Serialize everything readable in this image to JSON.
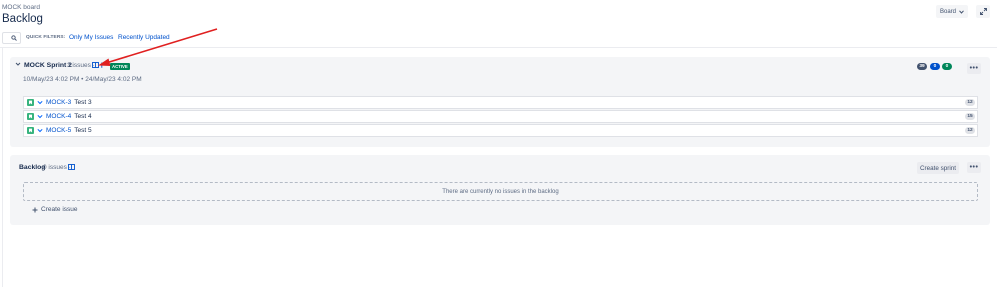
{
  "header": {
    "breadcrumb": "MOCK board",
    "title": "Backlog",
    "board_button": "Board",
    "board_button_icon": "chevron-down-icon",
    "expand_icon": "expand-icon"
  },
  "filters": {
    "search_icon": "search-icon",
    "quick_filters_label": "QUICK FILTERS:",
    "items": [
      "Only My Issues",
      "Recently Updated"
    ]
  },
  "sprint": {
    "name": "MOCK Sprint 2",
    "issue_count": "3 issues",
    "separator": "·",
    "status": "ACTIVE",
    "dates": "10/May/23 4:02 PM  •  24/May/23 4:02 PM",
    "points": [
      {
        "value": "39",
        "color": "#42526e"
      },
      {
        "value": "0",
        "color": "#0052cc"
      },
      {
        "value": "0",
        "color": "#00875a"
      }
    ],
    "more_label": "•••",
    "issues": [
      {
        "key": "MOCK-3",
        "summary": "Test 3",
        "estimate": "12"
      },
      {
        "key": "MOCK-4",
        "summary": "Test 4",
        "estimate": "15"
      },
      {
        "key": "MOCK-5",
        "summary": "Test 5",
        "estimate": "12"
      }
    ]
  },
  "backlog": {
    "name": "Backlog",
    "issue_count": "0 issues",
    "separator": "·",
    "create_sprint": "Create sprint",
    "more_label": "•••",
    "empty_message": "There are currently no issues in the backlog",
    "create_issue": "Create issue"
  },
  "colors": {
    "accent": "#0052cc",
    "active": "#00875a",
    "story": "#36b37e",
    "annotation_arrow": "#e02020"
  }
}
